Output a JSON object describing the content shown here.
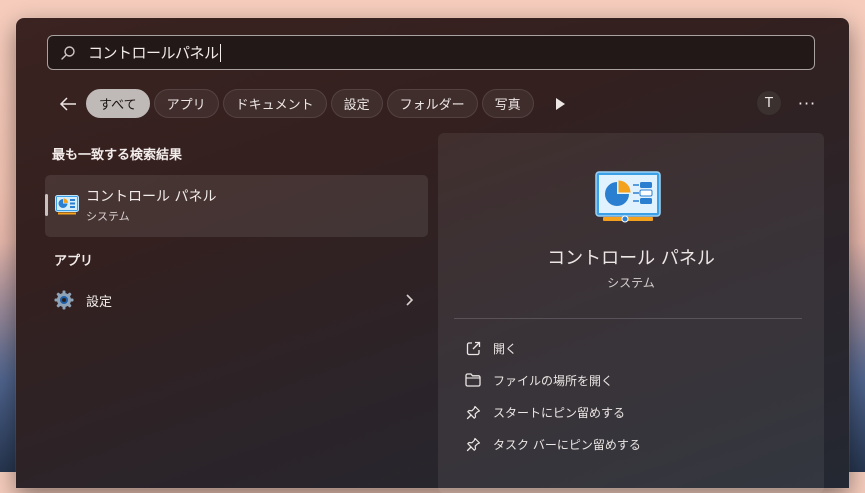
{
  "search": {
    "value": "コントロールパネル"
  },
  "filters": {
    "items": [
      {
        "label": "すべて",
        "active": true
      },
      {
        "label": "アプリ",
        "active": false
      },
      {
        "label": "ドキュメント",
        "active": false
      },
      {
        "label": "設定",
        "active": false
      },
      {
        "label": "フォルダー",
        "active": false
      },
      {
        "label": "写真",
        "active": false
      }
    ]
  },
  "account": {
    "initial": "T"
  },
  "more_label": "···",
  "best_match": {
    "section_title": "最も一致する検索結果",
    "name": "コントロール パネル",
    "category": "システム"
  },
  "apps": {
    "section_title": "アプリ",
    "items": [
      {
        "label": "設定"
      }
    ]
  },
  "detail": {
    "title": "コントロール パネル",
    "subtitle": "システム",
    "actions": [
      {
        "label": "開く",
        "icon": "open-external-icon"
      },
      {
        "label": "ファイルの場所を開く",
        "icon": "folder-icon"
      },
      {
        "label": "スタートにピン留めする",
        "icon": "pin-icon"
      },
      {
        "label": "タスク バーにピン留めする",
        "icon": "pin-icon"
      }
    ]
  },
  "colors": {
    "accent_chip": "#bfb9b7",
    "icon_blue": "#3ca0e6",
    "icon_orange": "#f4a11d"
  }
}
